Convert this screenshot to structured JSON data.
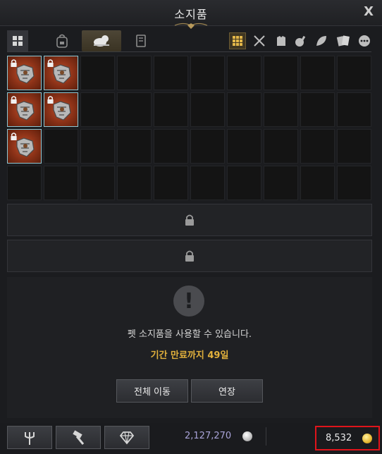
{
  "window": {
    "title": "소지품",
    "close_label": "X"
  },
  "tabs": [
    {
      "icon": "grid-view-icon",
      "active": false
    },
    {
      "icon": "backpack-icon",
      "active": false
    },
    {
      "icon": "pet-icon",
      "active": true
    },
    {
      "icon": "book-icon",
      "active": false
    }
  ],
  "filters": [
    {
      "icon": "all-items-grid-icon",
      "active": true
    },
    {
      "icon": "crossed-swords-icon",
      "active": false
    },
    {
      "icon": "armor-icon",
      "active": false
    },
    {
      "icon": "potion-icon",
      "active": false
    },
    {
      "icon": "leaf-icon",
      "active": false
    },
    {
      "icon": "cards-icon",
      "active": false
    },
    {
      "icon": "more-icon",
      "active": false
    }
  ],
  "inventory": {
    "items": [
      {
        "name": "armor-gauntlet",
        "locked": true
      },
      {
        "name": "armor-glove",
        "locked": true
      },
      {
        "name": "armor-boots",
        "locked": true
      },
      {
        "name": "armor-claw",
        "locked": true
      },
      {
        "name": "armor-helm",
        "locked": true
      }
    ]
  },
  "info": {
    "message": "펫 소지품을 사용할 수 있습니다.",
    "expiry": "기간 만료까지 49일",
    "move_all_label": "전체 이동",
    "extend_label": "연장"
  },
  "currency": {
    "silver": "2,127,270",
    "gold": "8,532",
    "gold_highlight_color": "#e0141b"
  },
  "bottom_tools": [
    {
      "icon": "trident-icon"
    },
    {
      "icon": "hammer-icon"
    },
    {
      "icon": "diamond-icon"
    }
  ]
}
